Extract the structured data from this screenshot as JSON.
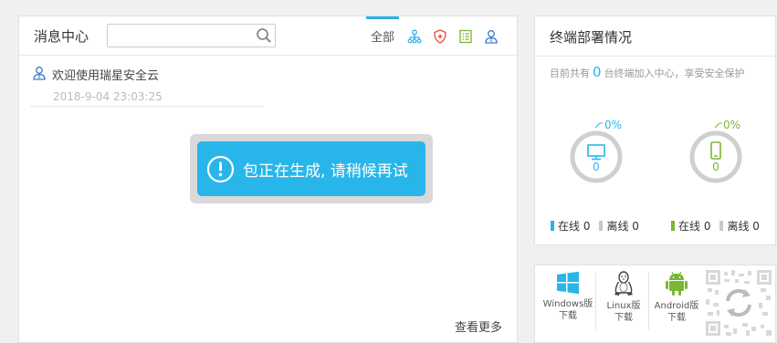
{
  "messages": {
    "title": "消息中心",
    "search_value": "",
    "search_placeholder": "",
    "tab_all": "全部",
    "items": [
      {
        "text": "欢迎使用瑞星安全云",
        "time": "2018-9-04 23:03:25"
      }
    ],
    "view_more": "查看更多"
  },
  "toast": {
    "text": "包正在生成, 请稍候再试"
  },
  "deploy": {
    "title": "终端部署情况",
    "summary_prefix": "目前共有",
    "count": "0",
    "summary_suffix": "台终端加入中心，享受安全保护",
    "pc": {
      "percent": "0%",
      "count": "0",
      "online": "在线 0",
      "offline": "离线 0"
    },
    "mobile": {
      "percent": "0%",
      "count": "0",
      "online": "在线 0",
      "offline": "离线 0"
    }
  },
  "downloads": {
    "windows_line1": "Windows版",
    "windows_line2": "下载",
    "linux_line1": "Linux版",
    "linux_line2": "下载",
    "android_line1": "Android版",
    "android_line2": "下载"
  },
  "colors": {
    "accent_blue": "#28b6ea",
    "accent_green": "#7ab536",
    "shield_red": "#e84c3d",
    "gray": "#c8c8c8"
  }
}
